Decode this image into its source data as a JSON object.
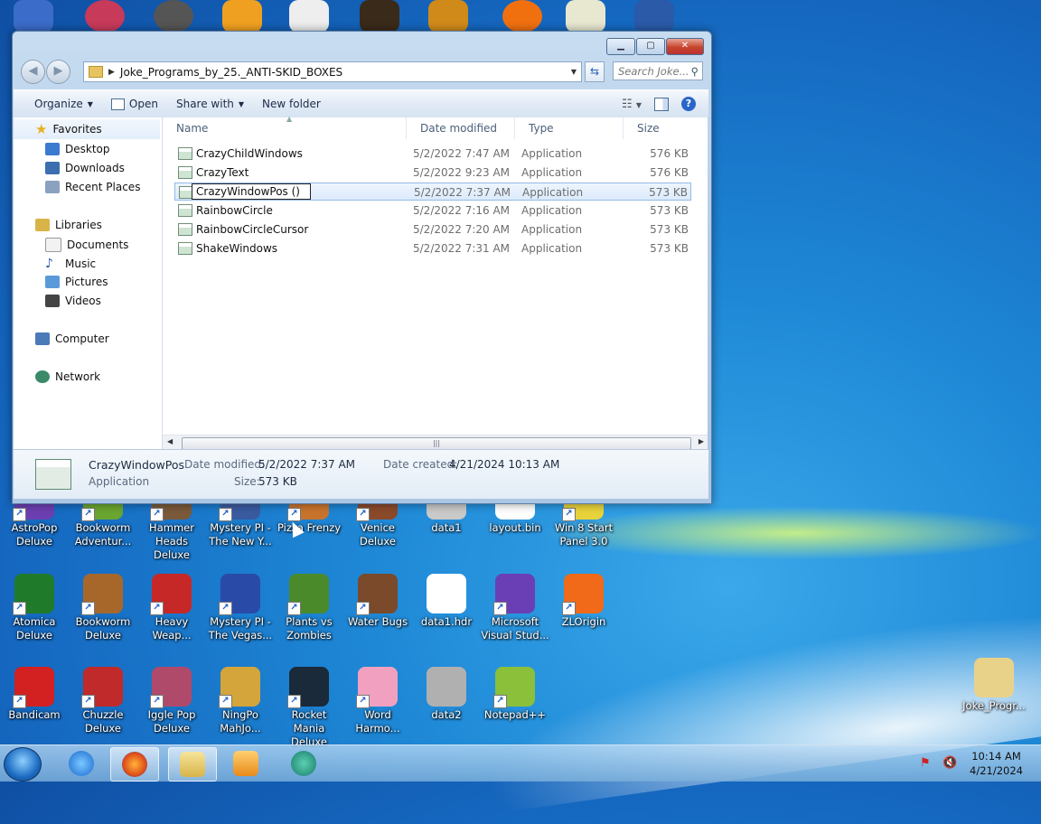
{
  "window": {
    "address": {
      "path": "Joke_Programs_by_25._ANTI-SKID_BOXES"
    },
    "search_placeholder": "Search Joke...",
    "caption": {
      "minimize": "▁",
      "maximize": "▢",
      "close": "✕"
    },
    "toolbar": {
      "organize": "Organize",
      "open": "Open",
      "share_with": "Share with",
      "new_folder": "New folder"
    },
    "nav": {
      "favorites": "Favorites",
      "desktop": "Desktop",
      "downloads": "Downloads",
      "recent": "Recent Places",
      "libraries": "Libraries",
      "documents": "Documents",
      "music": "Music",
      "pictures": "Pictures",
      "videos": "Videos",
      "computer": "Computer",
      "network": "Network"
    },
    "columns": {
      "name": "Name",
      "date": "Date modified",
      "type": "Type",
      "size": "Size"
    },
    "files": [
      {
        "name": "CrazyChildWindows",
        "date": "5/2/2022 7:47 AM",
        "type": "Application",
        "size": "576 KB"
      },
      {
        "name": "CrazyText",
        "date": "5/2/2022 9:23 AM",
        "type": "Application",
        "size": "576 KB"
      },
      {
        "name": "CrazyWindowPos ()",
        "date": "5/2/2022 7:37 AM",
        "type": "Application",
        "size": "573 KB"
      },
      {
        "name": "RainbowCircle",
        "date": "5/2/2022 7:16 AM",
        "type": "Application",
        "size": "573 KB"
      },
      {
        "name": "RainbowCircleCursor",
        "date": "5/2/2022 7:20 AM",
        "type": "Application",
        "size": "573 KB"
      },
      {
        "name": "ShakeWindows",
        "date": "5/2/2022 7:31 AM",
        "type": "Application",
        "size": "573 KB"
      }
    ],
    "details": {
      "name": "CrazyWindowPos",
      "type": "Application",
      "date_modified_label": "Date modified:",
      "date_modified": "5/2/2022 7:37 AM",
      "size_label": "Size:",
      "size": "573 KB",
      "date_created_label": "Date created:",
      "date_created": "4/21/2024 10:13 AM"
    }
  },
  "desktop_icons": [
    {
      "l1": "AstroPop",
      "l2": "Deluxe",
      "color": "#6c3fb0",
      "shortcut": true
    },
    {
      "l1": "Bookworm",
      "l2": "Adventur...",
      "color": "#6aa52f",
      "shortcut": true
    },
    {
      "l1": "Hammer",
      "l2": "Heads Deluxe",
      "color": "#7a5a3a",
      "shortcut": true
    },
    {
      "l1": "Mystery PI -",
      "l2": "The New Y...",
      "color": "#3a5aa0",
      "shortcut": true
    },
    {
      "l1": "Pizza Frenzy",
      "l2": "",
      "color": "#c8732d",
      "shortcut": true
    },
    {
      "l1": "Venice",
      "l2": "Deluxe",
      "color": "#8a4a2a",
      "shortcut": true
    },
    {
      "l1": "data1",
      "l2": "",
      "color": "#c9c9c9",
      "shortcut": false
    },
    {
      "l1": "layout.bin",
      "l2": "",
      "color": "#ffffff",
      "shortcut": false
    },
    {
      "l1": "Win 8 Start",
      "l2": "Panel 3.0",
      "color": "#e8d23a",
      "shortcut": true
    },
    {
      "l1": "Atomica",
      "l2": "Deluxe",
      "color": "#1f7a2a",
      "shortcut": true
    },
    {
      "l1": "Bookworm",
      "l2": "Deluxe",
      "color": "#a8672a",
      "shortcut": true
    },
    {
      "l1": "Heavy",
      "l2": "Weap...",
      "color": "#c62828",
      "shortcut": true
    },
    {
      "l1": "Mystery PI -",
      "l2": "The Vegas...",
      "color": "#2a4aa8",
      "shortcut": true
    },
    {
      "l1": "Plants vs",
      "l2": "Zombies",
      "color": "#4a8a2a",
      "shortcut": true
    },
    {
      "l1": "Water Bugs",
      "l2": "",
      "color": "#7a4a2a",
      "shortcut": true
    },
    {
      "l1": "data1.hdr",
      "l2": "",
      "color": "#ffffff",
      "shortcut": false
    },
    {
      "l1": "Microsoft",
      "l2": "Visual Stud...",
      "color": "#6a3fb5",
      "shortcut": true
    },
    {
      "l1": "ZLOrigin",
      "l2": "",
      "color": "#f06a1a",
      "shortcut": true
    },
    {
      "l1": "Bandicam",
      "l2": "",
      "color": "#d32020",
      "shortcut": true
    },
    {
      "l1": "Chuzzle",
      "l2": "Deluxe",
      "color": "#c02a2a",
      "shortcut": true
    },
    {
      "l1": "Iggle Pop",
      "l2": "Deluxe",
      "color": "#b04a6a",
      "shortcut": true
    },
    {
      "l1": "NingPo",
      "l2": "MahJo...",
      "color": "#d4a53a",
      "shortcut": true
    },
    {
      "l1": "Rocket Mania",
      "l2": "Deluxe",
      "color": "#1a2a3a",
      "shortcut": true
    },
    {
      "l1": "Word",
      "l2": "Harmo...",
      "color": "#f2a0c0",
      "shortcut": true
    },
    {
      "l1": "data2",
      "l2": "",
      "color": "#b0b0b0",
      "shortcut": false
    },
    {
      "l1": "Notepad++",
      "l2": "",
      "color": "#8ac03a",
      "shortcut": true
    },
    {
      "l1": "Joke_Progr...",
      "l2": "",
      "color": "#e8d28a",
      "shortcut": false
    }
  ],
  "taskbar": {
    "time": "10:14 AM",
    "date": "4/21/2024"
  }
}
